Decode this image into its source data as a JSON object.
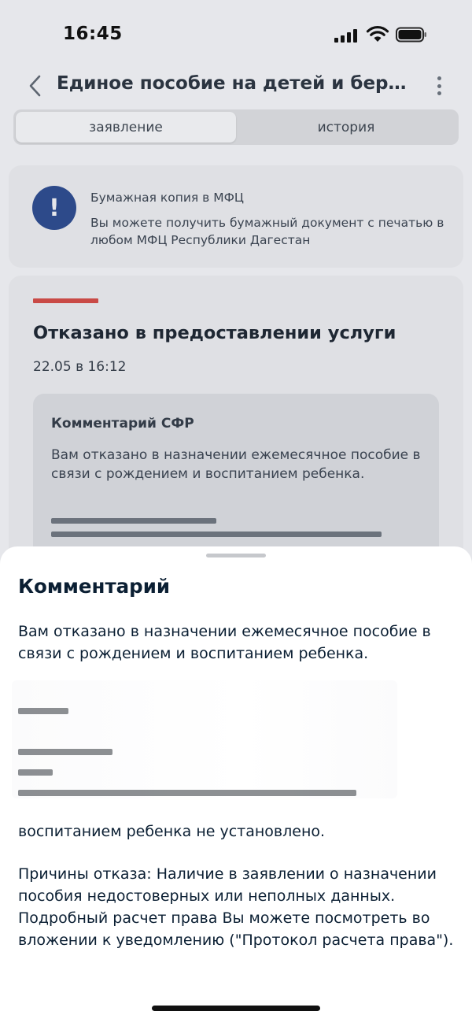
{
  "status_bar": {
    "time": "16:45"
  },
  "nav": {
    "title": "Единое пособие на детей и беременных"
  },
  "tabs": [
    {
      "label": "заявление",
      "active": true
    },
    {
      "label": "история",
      "active": false
    }
  ],
  "info_card": {
    "title": "Бумажная копия в МФЦ",
    "text": "Вы можете получить бумажный документ с печатью в любом МФЦ Республики Дагестан"
  },
  "status_card": {
    "heading": "Отказано в предоставлении услуги",
    "date": "22.05 в 16:12",
    "accent_color": "#c94a46",
    "comment": {
      "title": "Комментарий СФР",
      "body": "Вам отказано в назначении ежемесячное пособие в связи с рождением и воспитанием ребенка."
    }
  },
  "sheet": {
    "title": "Комментарий",
    "paragraph1": "Вам отказано в назначении ежемесячное пособие в связи с рождением и воспитанием ребенка.",
    "paragraph2": "воспитанием ребенка не установлено.",
    "paragraph3": "Причины отказа: Наличие в заявлении о назначении пособия недостоверных или неполных данных. Подробный расчет права Вы можете посмотреть во вложении к уведомлению (\"Протокол расчета права\")."
  },
  "colors": {
    "info_icon": "#2d4a8a",
    "text_primary": "#0b1f33"
  }
}
